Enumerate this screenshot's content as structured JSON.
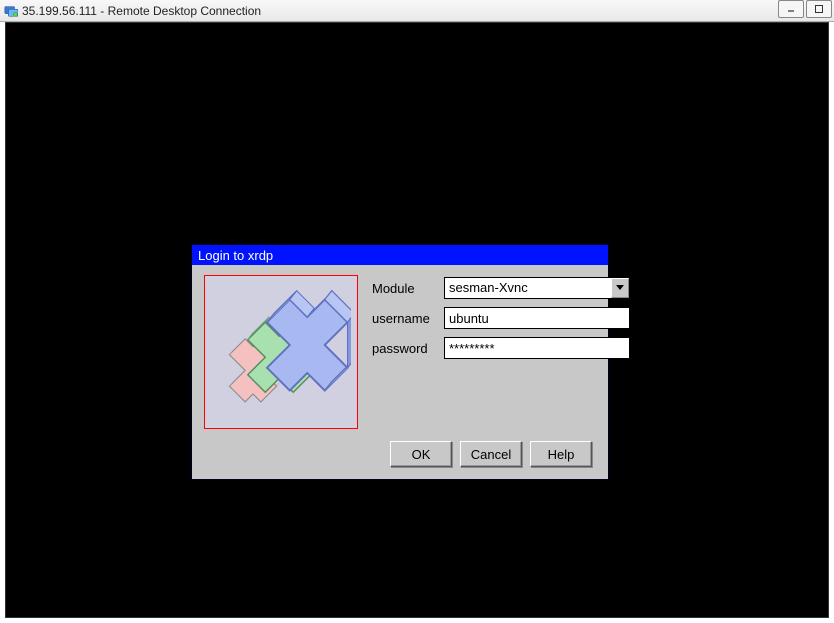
{
  "window": {
    "title": "35.199.56.111 - Remote Desktop Connection",
    "buttons": {
      "minimize": "_",
      "maximize": "⧉",
      "close": "✕"
    }
  },
  "dialog": {
    "title": "Login to xrdp",
    "logo_alt": "xrdp-logo",
    "fields": {
      "module": {
        "label": "Module",
        "value": "sesman-Xvnc"
      },
      "username": {
        "label": "username",
        "value": "ubuntu"
      },
      "password": {
        "label": "password",
        "value": "*********"
      }
    },
    "buttons": {
      "ok": "OK",
      "cancel": "Cancel",
      "help": "Help"
    }
  }
}
